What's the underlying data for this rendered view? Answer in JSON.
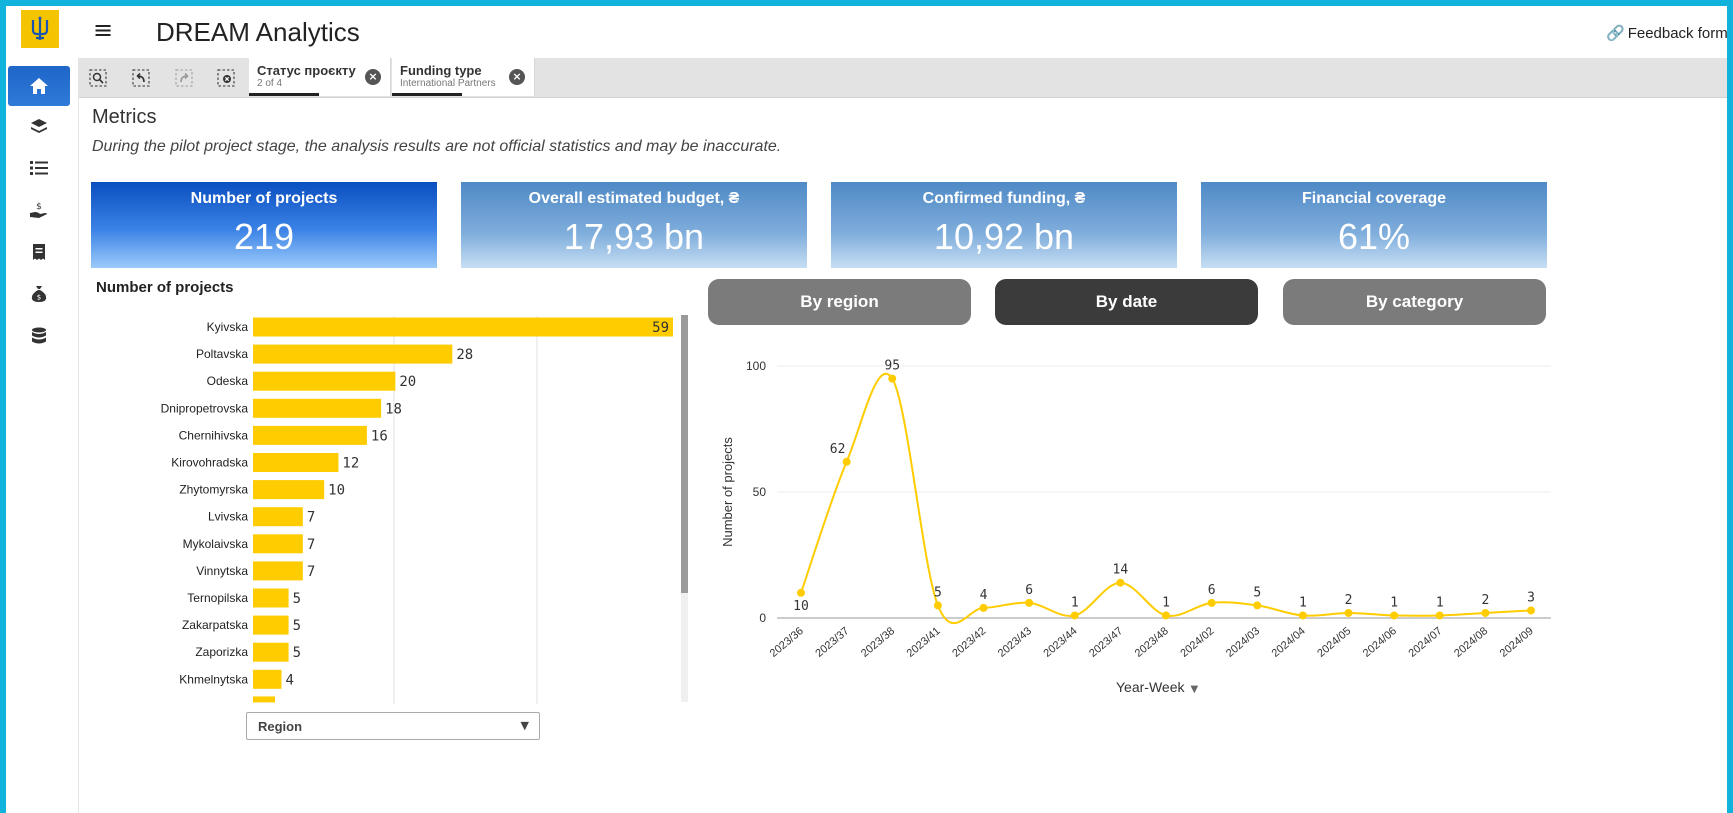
{
  "header": {
    "app_title": "DREAM Analytics",
    "feedback_label": "Feedback form",
    "logo_icon": "trident-emblem",
    "menu_icon": "hamburger-icon"
  },
  "sidebar": {
    "items": [
      {
        "icon": "home-icon",
        "active": true
      },
      {
        "icon": "layers-icon",
        "active": false
      },
      {
        "icon": "list-icon",
        "active": false
      },
      {
        "icon": "hand-money-icon",
        "active": false
      },
      {
        "icon": "receipt-icon",
        "active": false
      },
      {
        "icon": "money-bag-icon",
        "active": false
      },
      {
        "icon": "database-icon",
        "active": false
      }
    ]
  },
  "toolbar": {
    "tools": [
      "search-selections-icon",
      "step-back-icon",
      "step-forward-icon",
      "clear-selections-icon"
    ],
    "filters": [
      {
        "title": "Статус проєкту",
        "subtitle": "2 of 4"
      },
      {
        "title": "Funding type",
        "subtitle": "International Partners"
      }
    ]
  },
  "main": {
    "title": "Metrics",
    "disclaimer": "During the pilot project stage, the analysis results are not official statistics and may be inaccurate."
  },
  "kpis": [
    {
      "label": "Number of projects",
      "value": "219"
    },
    {
      "label": "Overall estimated budget, ₴",
      "value": "17,93 bn"
    },
    {
      "label": "Confirmed funding, ₴",
      "value": "10,92 bn"
    },
    {
      "label": "Financial coverage",
      "value": "61%"
    }
  ],
  "colors": {
    "accent_yellow": "#FFCC00",
    "kpi_blue_dark": "#0A4FC0",
    "kpi_blue_light": "#80AEDC",
    "frame_cyan": "#10B3DC"
  },
  "toggle": {
    "options": [
      "By region",
      "By date",
      "By category"
    ],
    "selected": "By date"
  },
  "dimension_select": {
    "value": "Region"
  },
  "chart_data": [
    {
      "type": "bar",
      "orientation": "horizontal",
      "title": "Number of projects",
      "categories": [
        "Kyivska",
        "Poltavska",
        "Odeska",
        "Dnipropetrovska",
        "Chernihivska",
        "Kirovohradska",
        "Zhytomyrska",
        "Lvivska",
        "Mykolaivska",
        "Vinnytska",
        "Ternopilska",
        "Zakarpatska",
        "Zaporizka",
        "Khmelnytska"
      ],
      "values": [
        59,
        28,
        20,
        18,
        16,
        12,
        10,
        7,
        7,
        7,
        5,
        5,
        5,
        4
      ],
      "xlim": [
        0,
        59
      ],
      "grid": true,
      "color": "#FFCC00",
      "scrollable": true
    },
    {
      "type": "line",
      "xlabel": "Year-Week",
      "ylabel": "Number of projects",
      "x": [
        "2023/36",
        "2023/37",
        "2023/38",
        "2023/41",
        "2023/42",
        "2023/43",
        "2023/44",
        "2023/47",
        "2023/48",
        "2024/02",
        "2024/03",
        "2024/04",
        "2024/05",
        "2024/06",
        "2024/07",
        "2024/08",
        "2024/09"
      ],
      "values": [
        10,
        62,
        95,
        5,
        4,
        6,
        1,
        14,
        1,
        6,
        5,
        1,
        2,
        1,
        1,
        2,
        3
      ],
      "ylim": [
        0,
        100
      ],
      "yticks": [
        0,
        50,
        100
      ],
      "grid": true,
      "smooth": true,
      "color": "#FFCC00"
    }
  ]
}
